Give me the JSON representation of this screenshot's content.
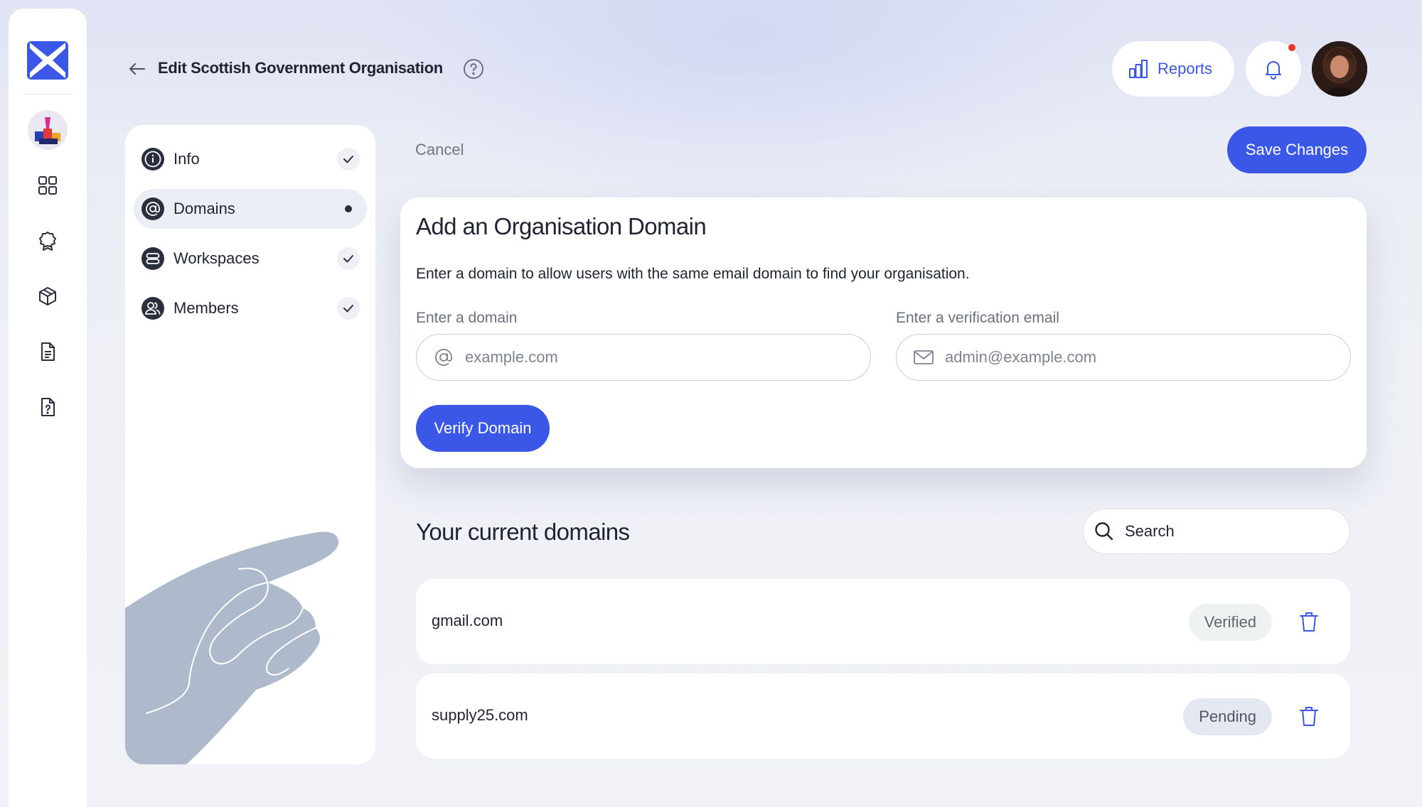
{
  "header": {
    "title": "Edit Scottish Government Organisation",
    "reports_label": "Reports"
  },
  "steps": [
    {
      "label": "Info",
      "icon": "info-icon",
      "status": "complete"
    },
    {
      "label": "Domains",
      "icon": "at-sign-icon",
      "status": "current"
    },
    {
      "label": "Workspaces",
      "icon": "server-icon",
      "status": "complete"
    },
    {
      "label": "Members",
      "icon": "users-icon",
      "status": "complete"
    }
  ],
  "actions": {
    "cancel_label": "Cancel",
    "save_label": "Save Changes"
  },
  "add_domain": {
    "title": "Add an Organisation Domain",
    "description": "Enter a domain to allow users with the same email domain to find your organisation.",
    "domain_label": "Enter a domain",
    "domain_placeholder": "example.com",
    "email_label": "Enter a verification email",
    "email_placeholder": "admin@example.com",
    "verify_label": "Verify Domain"
  },
  "current_domains": {
    "title": "Your current domains",
    "search_label": "Search",
    "rows": [
      {
        "domain": "gmail.com",
        "status": "Verified"
      },
      {
        "domain": "supply25.com",
        "status": "Pending"
      }
    ]
  },
  "colors": {
    "accent": "#3a57e8",
    "notification": "#e8382c"
  }
}
